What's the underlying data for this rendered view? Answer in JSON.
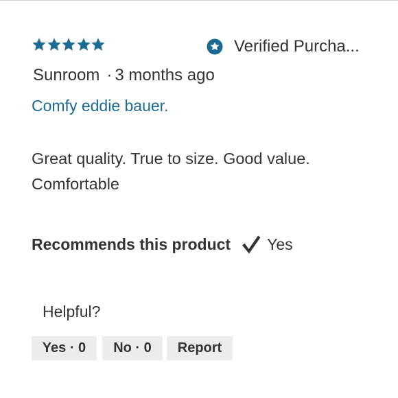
{
  "review": {
    "rating": 5,
    "rating_max": 5,
    "star_color": "#1b6a92",
    "verified_label": "Verified Purcha...",
    "author": "Sunroom",
    "separator": "·",
    "posted": "3 months ago",
    "title": "Comfy eddie bauer.",
    "title_color": "#1b6a92",
    "body_lines": [
      "Great quality. True to size. Good value.",
      "Comfortable"
    ],
    "recommends_label": "Recommends this product",
    "recommends_value": "Yes"
  },
  "feedback": {
    "helpful_label": "Helpful?",
    "yes_button": "Yes · 0",
    "no_button": "No · 0",
    "report_button": "Report"
  },
  "icons": {
    "star": "star-icon",
    "verified": "verified-badge-icon",
    "check": "checkmark-icon"
  }
}
